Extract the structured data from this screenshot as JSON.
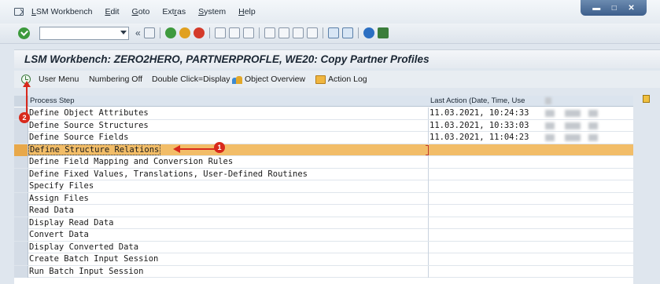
{
  "menu": {
    "items": [
      {
        "text": "LSM Workbench",
        "ul": "L"
      },
      {
        "text": "Edit",
        "ul": "E"
      },
      {
        "text": "Goto",
        "ul": "G"
      },
      {
        "text": "Extras",
        "ul": "r"
      },
      {
        "text": "System",
        "ul": "S"
      },
      {
        "text": "Help",
        "ul": "H"
      }
    ]
  },
  "toolbar": {
    "command_value": ""
  },
  "title": "LSM Workbench: ZERO2HERO, PARTNERPROFLE, WE20: Copy Partner Profiles",
  "app_toolbar": {
    "user_menu": "User Menu",
    "numbering_off": "Numbering Off",
    "double_click": "Double Click=Display",
    "object_overview": "Object Overview",
    "action_log": "Action Log"
  },
  "table": {
    "headers": [
      "Process Step",
      "Last Action (Date, Time, Use"
    ],
    "rows": [
      {
        "step": "Define Object Attributes",
        "last": "11.03.2021, 10:24:33"
      },
      {
        "step": "Define Source Structures",
        "last": "11.03.2021, 10:33:03"
      },
      {
        "step": "Define Source Fields",
        "last": "11.03.2021, 11:04:23"
      },
      {
        "step": "Define Structure Relations",
        "last": ""
      },
      {
        "step": "Define Field Mapping and Conversion Rules",
        "last": ""
      },
      {
        "step": "Define Fixed Values, Translations, User-Defined Routines",
        "last": ""
      },
      {
        "step": "Specify Files",
        "last": ""
      },
      {
        "step": "Assign Files",
        "last": ""
      },
      {
        "step": "Read Data",
        "last": ""
      },
      {
        "step": "Display Read Data",
        "last": ""
      },
      {
        "step": "Convert Data",
        "last": ""
      },
      {
        "step": "Display Converted Data",
        "last": ""
      },
      {
        "step": "Create Batch Input Session",
        "last": ""
      },
      {
        "step": "Run Batch Input Session",
        "last": ""
      }
    ]
  },
  "callouts": {
    "one": "1",
    "two": "2"
  },
  "colors": {
    "highlight": "#f2bd68",
    "callout": "#d8291c"
  }
}
